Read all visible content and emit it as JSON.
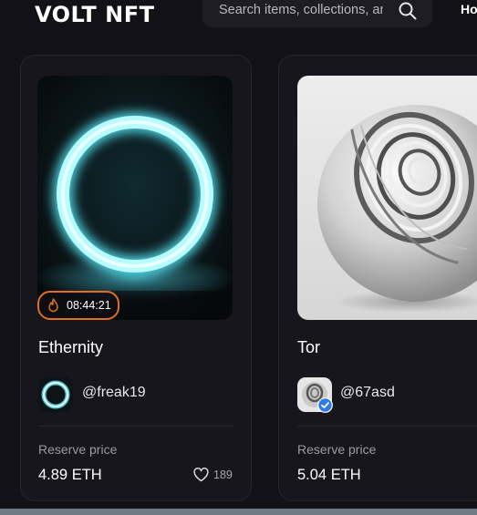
{
  "brand": {
    "logo_text": "VOLT NFT"
  },
  "search": {
    "placeholder": "Search items, collections, and accounts"
  },
  "nav": {
    "partial_item": "Ho"
  },
  "cards": [
    {
      "title": "Ethernity",
      "timer": "08:44:21",
      "creator": "@freak19",
      "reserve_label": "Reserve price",
      "price": "4.89 ETH",
      "likes": "189"
    },
    {
      "title": "Tor",
      "creator": "@67asd",
      "reserve_label": "Reserve price",
      "price": "5.04 ETH"
    }
  ],
  "colors": {
    "background": "#121117",
    "card": "#17161c",
    "timer_border": "#e0701f",
    "glow_ring": "#8ff4ff",
    "verified": "#2f7be5"
  },
  "icons": [
    "search-icon",
    "fire-icon",
    "heart-icon",
    "verified-icon"
  ]
}
